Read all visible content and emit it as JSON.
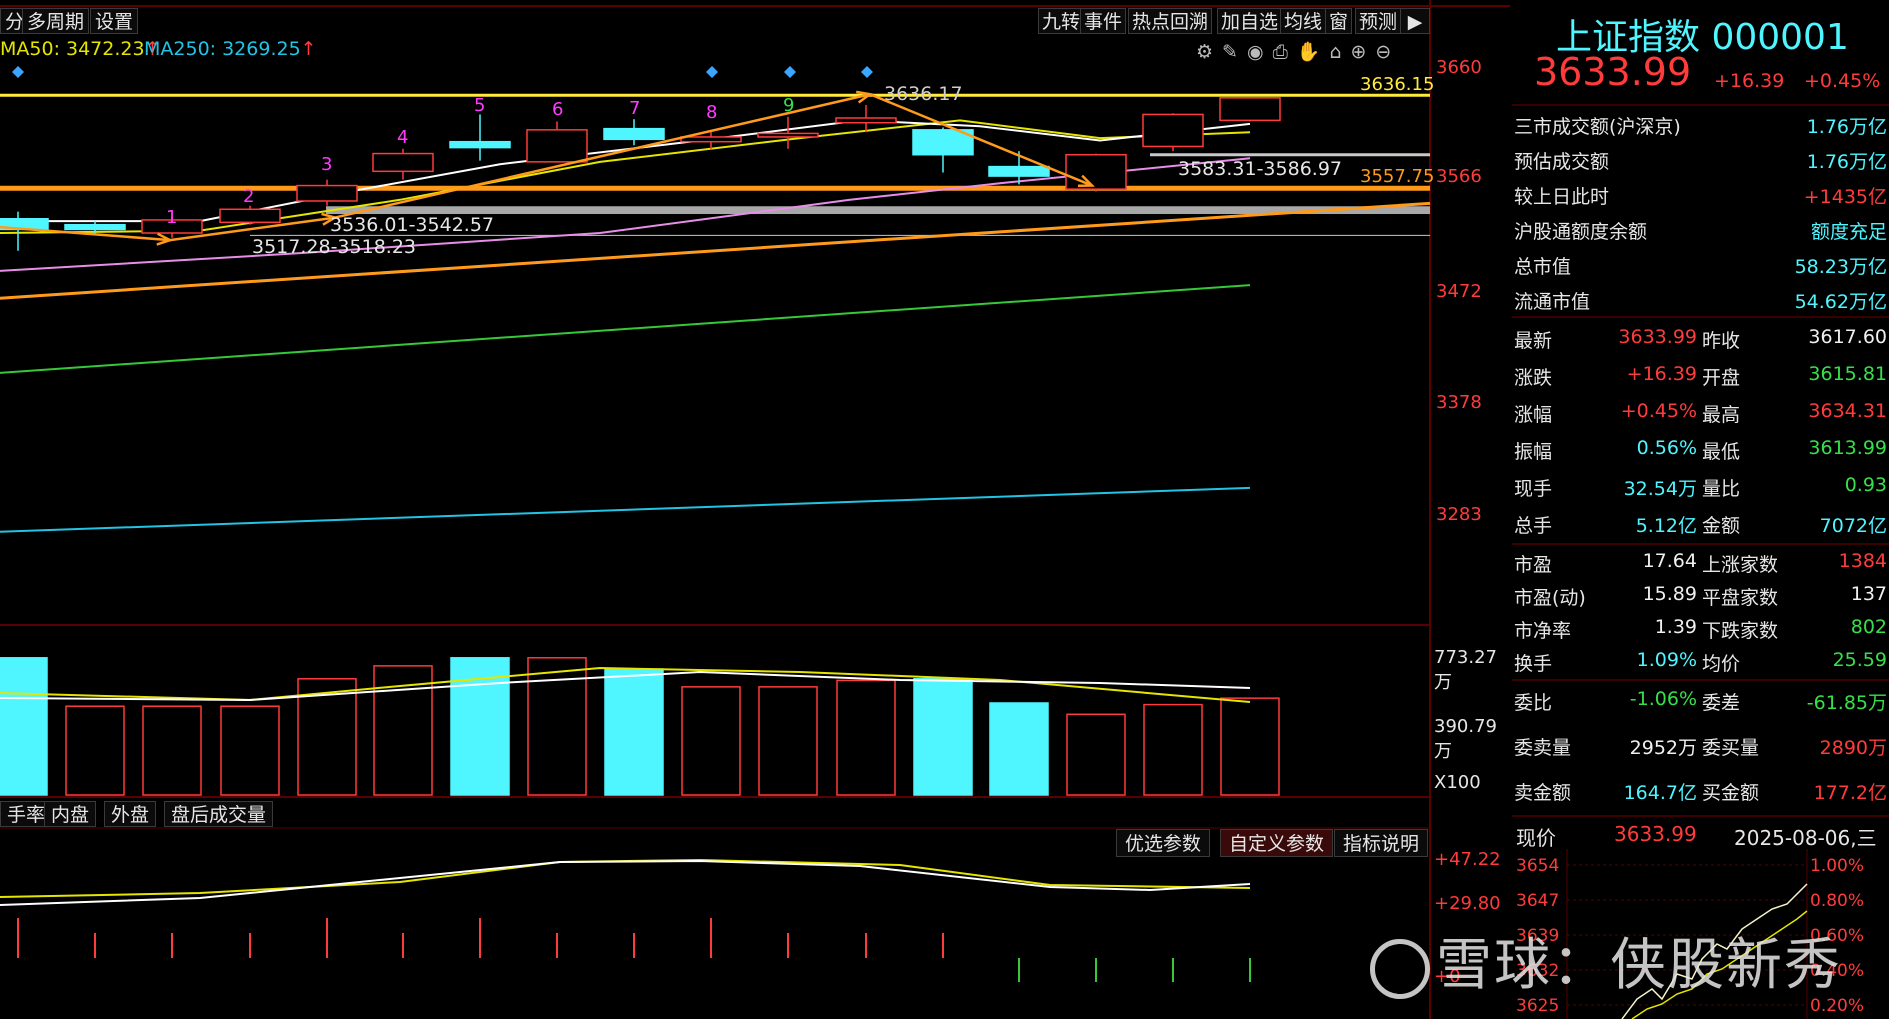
{
  "topbar": {
    "left": [
      "分",
      "多周期",
      "设置"
    ],
    "right": [
      "九转",
      "事件",
      "热点回溯",
      "加自选",
      "均线",
      "窗",
      "预测"
    ]
  },
  "ma": {
    "ma50": "MA50: 3472.23",
    "ma50_arrow": "↑",
    "ma250": "MA250: 3269.25",
    "ma250_arrow": "↑"
  },
  "price_axis": [
    "3660",
    "3566",
    "3472",
    "3378",
    "3283"
  ],
  "lines": {
    "high_label": "3636.15",
    "support_label": "3557.75",
    "peak_label": "3636.17",
    "gap1_label": "3583.31-3586.97",
    "gap2_label": "3536.01-3542.57",
    "gap3_label": "3517.28-3518.23"
  },
  "nine_counts": [
    "1",
    "2",
    "3",
    "4",
    "5",
    "6",
    "7",
    "8",
    "9"
  ],
  "volume_axis": [
    "773.27万",
    "390.79万",
    "X100"
  ],
  "tabs": [
    "手率",
    "内盘",
    "外盘",
    "盘后成交量"
  ],
  "params": [
    "优选参数",
    "自定义参数",
    "指标说明"
  ],
  "osc_axis": [
    "+47.22",
    "+29.80",
    "+0"
  ],
  "colors": {
    "up": "#ff3b3b",
    "down": "#4ff5ff",
    "ma_yellow": "#e5e500",
    "ma_white": "#ffffff",
    "ma_pink": "#e88ee8",
    "ma_orange": "#ff9a1a",
    "ma_green": "#35c93a",
    "ma_cyan": "#21c4e6"
  },
  "panel": {
    "title": "上证指数 000001",
    "price": "3633.99",
    "change": "+16.39",
    "change_pct": "+0.45%",
    "rows": [
      {
        "label": "三市成交额(沪深京)",
        "value": "1.76万亿",
        "color": "cyan"
      },
      {
        "label": "预估成交额",
        "value": "1.76万亿",
        "color": "cyan"
      },
      {
        "label": "较上日此时",
        "value": "+1435亿",
        "color": "red"
      },
      {
        "label": "沪股通额度余额",
        "value": "额度充足",
        "color": "cyan"
      },
      {
        "label": "总市值",
        "value": "58.23万亿",
        "color": "cyan"
      },
      {
        "label": "流通市值",
        "value": "54.62万亿",
        "color": "cyan"
      }
    ],
    "quotes": [
      {
        "l1": "最新",
        "v1": "3633.99",
        "c1": "red",
        "l2": "昨收",
        "v2": "3617.60",
        "c2": "white"
      },
      {
        "l1": "涨跌",
        "v1": "+16.39",
        "c1": "red",
        "l2": "开盘",
        "v2": "3615.81",
        "c2": "green"
      },
      {
        "l1": "涨幅",
        "v1": "+0.45%",
        "c1": "red",
        "l2": "最高",
        "v2": "3634.31",
        "c2": "red"
      },
      {
        "l1": "振幅",
        "v1": "0.56%",
        "c1": "cyan",
        "l2": "最低",
        "v2": "3613.99",
        "c2": "green"
      },
      {
        "l1": "现手",
        "v1": "32.54万",
        "c1": "cyan",
        "l2": "量比",
        "v2": "0.93",
        "c2": "green"
      },
      {
        "l1": "总手",
        "v1": "5.12亿",
        "c1": "cyan",
        "l2": "金额",
        "v2": "7072亿",
        "c2": "cyan"
      }
    ],
    "stats": [
      {
        "l1": "市盈",
        "v1": "17.64",
        "c1": "white",
        "l2": "上涨家数",
        "v2": "1384",
        "c2": "red"
      },
      {
        "l1": "市盈(动)",
        "v1": "15.89",
        "c1": "white",
        "l2": "平盘家数",
        "v2": "137",
        "c2": "white"
      },
      {
        "l1": "市净率",
        "v1": "1.39",
        "c1": "white",
        "l2": "下跌家数",
        "v2": "802",
        "c2": "green"
      },
      {
        "l1": "换手",
        "v1": "1.09%",
        "c1": "cyan",
        "l2": "均价",
        "v2": "25.59",
        "c2": "green"
      }
    ],
    "orders": [
      {
        "l1": "委比",
        "v1": "-1.06%",
        "c1": "green",
        "l2": "委差",
        "v2": "-61.85万",
        "c2": "green"
      },
      {
        "l1": "委卖量",
        "v1": "2952万",
        "c1": "white",
        "l2": "委买量",
        "v2": "2890万",
        "c2": "red"
      },
      {
        "l1": "卖金额",
        "v1": "164.7亿",
        "c1": "cyan",
        "l2": "买金额",
        "v2": "177.2亿",
        "c2": "red"
      }
    ],
    "intraday": {
      "label": "现价",
      "price": "3633.99",
      "date": "2025-08-06,三",
      "yaxis": [
        "3654",
        "3647",
        "3639",
        "3632",
        "3625"
      ],
      "pct": [
        "1.00%",
        "0.80%",
        "0.60%",
        "0.40%",
        "0.20%"
      ]
    }
  },
  "watermark": "雪球：侠股新秀"
}
